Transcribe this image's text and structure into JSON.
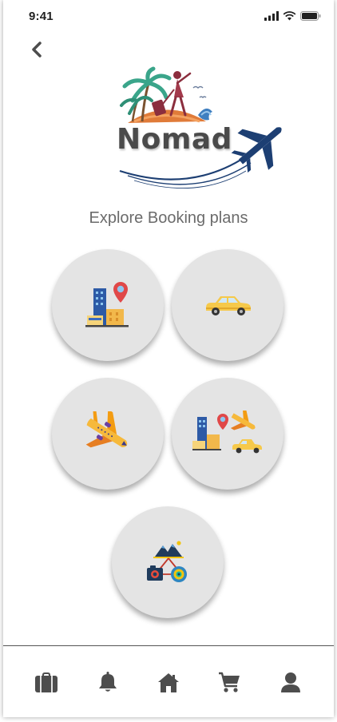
{
  "status_bar": {
    "time": "9:41",
    "icons": [
      "signal-icon",
      "wifi-icon",
      "battery-icon"
    ]
  },
  "header": {
    "back_icon": "chevron-left-icon",
    "logo_text": "Nomad"
  },
  "main": {
    "subtitle": "Explore Booking plans",
    "options": [
      {
        "icon": "hotel-location-icon"
      },
      {
        "icon": "taxi-car-icon"
      },
      {
        "icon": "airplane-icon"
      },
      {
        "icon": "package-combo-icon"
      },
      {
        "icon": "sightseeing-camera-icon"
      }
    ]
  },
  "bottom_nav": {
    "items": [
      {
        "icon": "briefcase-icon"
      },
      {
        "icon": "bell-icon"
      },
      {
        "icon": "home-icon"
      },
      {
        "icon": "cart-icon"
      },
      {
        "icon": "user-icon"
      }
    ]
  },
  "colors": {
    "circle_bg": "#e4e4e4",
    "nav_icon": "#4d4d4d",
    "subtitle": "#6b6b6b",
    "plane_blue": "#1d3f73",
    "taxi_yellow": "#f6c94a"
  }
}
